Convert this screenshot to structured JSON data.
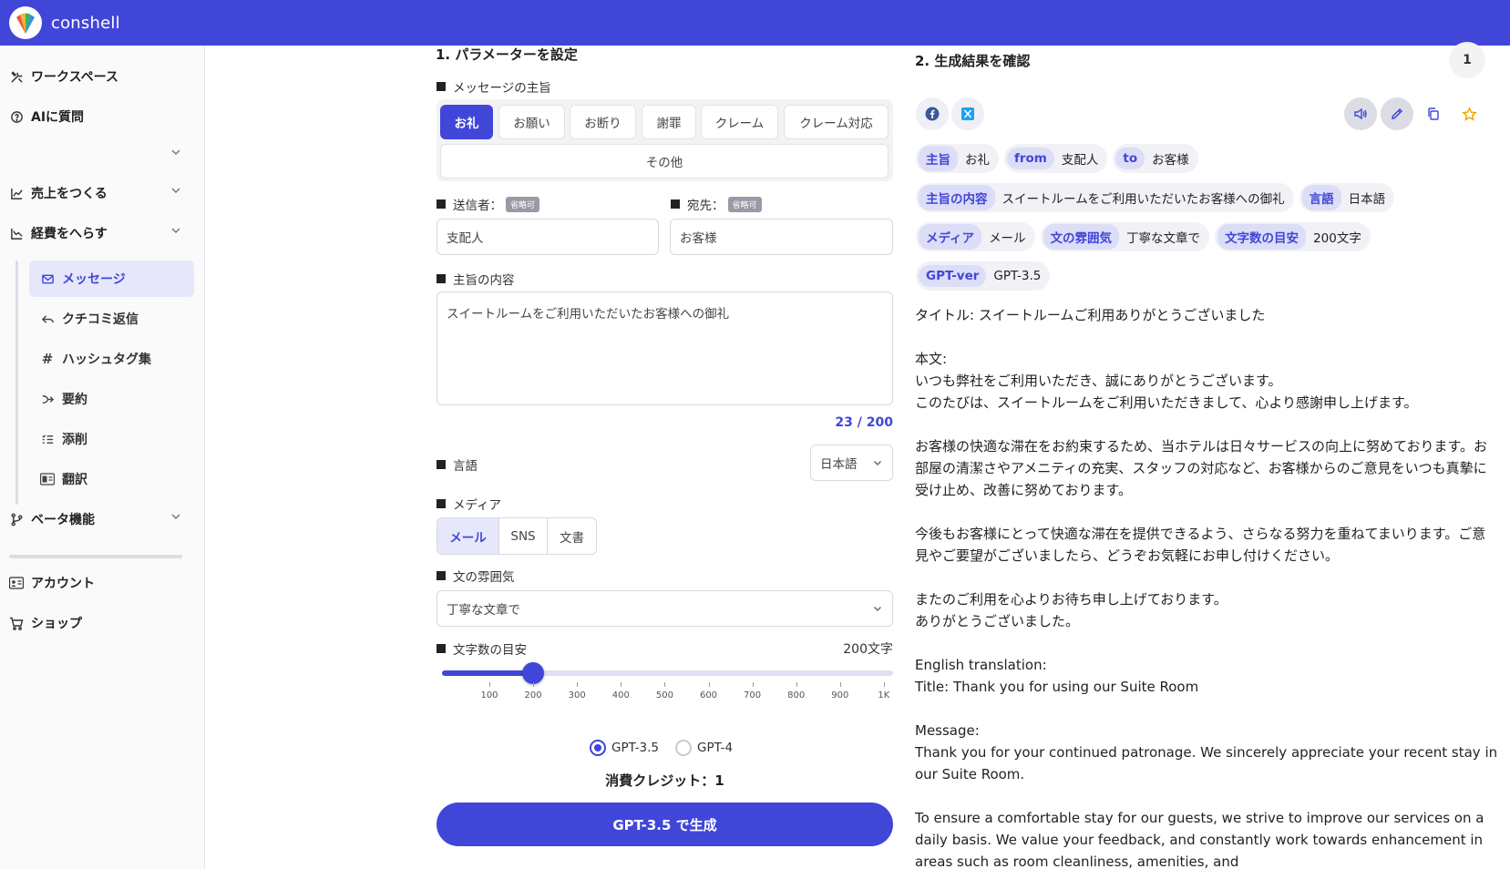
{
  "app": {
    "name": "conshell"
  },
  "sidebar": {
    "items": [
      {
        "label": "ワークスペース"
      },
      {
        "label": "AIに質問"
      },
      {
        "label": "売上をつくる"
      },
      {
        "label": "経費をへらす"
      }
    ],
    "sub_items": [
      {
        "label": "メッセージ"
      },
      {
        "label": "クチコミ返信"
      },
      {
        "label": "ハッシュタグ集"
      },
      {
        "label": "要約"
      },
      {
        "label": "添削"
      },
      {
        "label": "翻訳"
      }
    ],
    "beta": {
      "label": "ベータ機能"
    },
    "account": {
      "label": "アカウント"
    },
    "shop": {
      "label": "ショップ"
    }
  },
  "form": {
    "section_title": "1. パラメーターを設定",
    "purpose_label": "メッセージの主旨",
    "purpose_options": [
      "お礼",
      "お願い",
      "お断り",
      "謝罪",
      "クレーム",
      "クレーム対応",
      "その他"
    ],
    "sender_label": "送信者：",
    "recipient_label": "宛先：",
    "optional_badge": "省略可",
    "sender_value": "支配人",
    "recipient_value": "お客様",
    "content_label": "主旨の内容",
    "content_value": "スイートルームをご利用いただいたお客様への御礼",
    "counter": "23 / 200",
    "language_label": "言語",
    "language_value": "日本語",
    "media_label": "メディア",
    "media_options": [
      "メール",
      "SNS",
      "文書"
    ],
    "tone_label": "文の雰囲気",
    "tone_value": "丁寧な文章で",
    "length_label": "文字数の目安",
    "length_value": "200文字",
    "slider": {
      "value": 200,
      "min": 100,
      "max": 1000,
      "ticks": [
        "100",
        "200",
        "300",
        "400",
        "500",
        "600",
        "700",
        "800",
        "900",
        "1K"
      ]
    },
    "models": [
      "GPT-3.5",
      "GPT-4"
    ],
    "credit": "消費クレジット：1",
    "generate_label": "GPT-3.5 で生成"
  },
  "result": {
    "section_title": "2. 生成結果を確認",
    "page": "1",
    "tags": [
      [
        {
          "k": "主旨",
          "v": "お礼"
        },
        {
          "k": "from",
          "v": "支配人"
        },
        {
          "k": "to",
          "v": "お客様"
        }
      ],
      [
        {
          "k": "主旨の内容",
          "v": "スイートルームをご利用いただいたお客様への御礼"
        },
        {
          "k": "言語",
          "v": "日本語"
        }
      ],
      [
        {
          "k": "メディア",
          "v": "メール"
        },
        {
          "k": "文の雰囲気",
          "v": "丁寧な文章で"
        },
        {
          "k": "文字数の目安",
          "v": "200文字"
        }
      ],
      [
        {
          "k": "GPT-ver",
          "v": "GPT-3.5"
        }
      ]
    ],
    "text": "タイトル: スイートルームご利用ありがとうございました\n\n本文:\nいつも弊社をご利用いただき、誠にありがとうございます。\nこのたびは、スイートルームをご利用いただきまして、心より感謝申し上げます。\n\nお客様の快適な滞在をお約束するため、当ホテルは日々サービスの向上に努めております。お部屋の清潔さやアメニティの充実、スタッフの対応など、お客様からのご意見をいつも真摯に受け止め、改善に努めております。\n\n今後もお客様にとって快適な滞在を提供できるよう、さらなる努力を重ねてまいります。ご意見やご要望がございましたら、どうぞお気軽にお申し付けください。\n\nまたのご利用を心よりお待ち申し上げております。\nありがとうございました。\n\nEnglish translation:\nTitle: Thank you for using our Suite Room\n\nMessage:\nThank you for your continued patronage. We sincerely appreciate your recent stay in our Suite Room.\n\nTo ensure a comfortable stay for our guests, we strive to improve our services on a daily basis. We value your feedback, and constantly work towards enhancement in areas such as room cleanliness, amenities, and"
  },
  "colors": {
    "accent": "#4046d8",
    "header": "#4046d8",
    "accent_soft": "#e6e7fb",
    "star": "#f0a500"
  }
}
